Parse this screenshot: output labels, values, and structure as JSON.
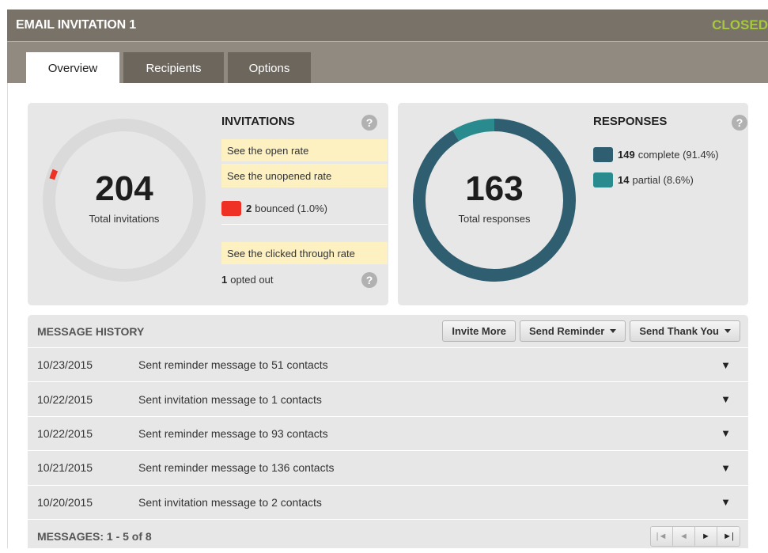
{
  "header": {
    "title": "EMAIL INVITATION 1",
    "status": "CLOSED",
    "status_color": "#a5c93d"
  },
  "tabs": [
    {
      "label": "Overview",
      "active": true
    },
    {
      "label": "Recipients"
    },
    {
      "label": "Options"
    }
  ],
  "invitations": {
    "title": "INVITATIONS",
    "help_icon": "?",
    "total": "204",
    "total_label": "Total invitations",
    "open_rate_link": "See the open rate",
    "unopened_rate_link": "See the unopened rate",
    "bounced_count": "2",
    "bounced_text": "bounced (1.0%)",
    "bounced_color": "#ee3124",
    "clicked_link": "See the clicked through rate",
    "opted_out_count": "1",
    "opted_out_text": "opted out",
    "bounced_fraction": 0.0098
  },
  "responses": {
    "title": "RESPONSES",
    "help_icon": "?",
    "total": "163",
    "total_label": "Total responses",
    "complete_count": "149",
    "complete_text": "complete (91.4%)",
    "complete_color": "#2e5e70",
    "partial_count": "14",
    "partial_text": "partial (8.6%)",
    "partial_color": "#2a8b8e",
    "complete_fraction": 0.914,
    "partial_fraction": 0.086
  },
  "history": {
    "title": "MESSAGE HISTORY",
    "invite_more": "Invite More",
    "send_reminder": "Send Reminder",
    "send_thank_you": "Send Thank You",
    "rows": [
      {
        "date": "10/23/2015",
        "message": "Sent reminder message to 51 contacts"
      },
      {
        "date": "10/22/2015",
        "message": "Sent invitation message to 1 contacts"
      },
      {
        "date": "10/22/2015",
        "message": "Sent reminder message to 93 contacts"
      },
      {
        "date": "10/21/2015",
        "message": "Sent reminder message to 136 contacts"
      },
      {
        "date": "10/20/2015",
        "message": "Sent invitation message to 2 contacts"
      }
    ],
    "expand_icon": "▼",
    "footer": "MESSAGES: 1 - 5 of 8",
    "pager": {
      "first": "|◄",
      "prev": "◄",
      "next": "►",
      "last": "►|"
    }
  }
}
